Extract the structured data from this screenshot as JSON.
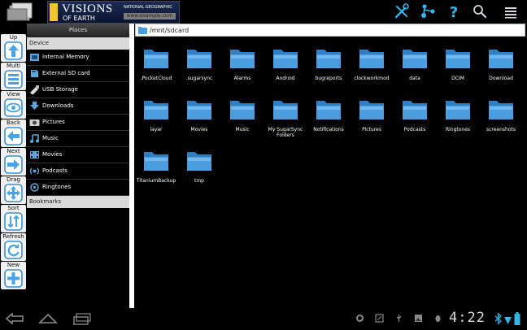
{
  "banner": {
    "title": "VISIONS",
    "subtitle": "OF EARTH",
    "brand": "NATIONAL GEOGRAPHIC",
    "link": "www.example.com"
  },
  "top_icons": [
    "tools-icon",
    "share-icon",
    "help-icon",
    "search-icon",
    "menu-icon"
  ],
  "toolbar": [
    {
      "label": "Up",
      "icon": "arrow-up-icon"
    },
    {
      "label": "Multi",
      "icon": "multi-select-icon"
    },
    {
      "label": "View",
      "icon": "view-icon"
    },
    {
      "label": "Back",
      "icon": "arrow-left-icon"
    },
    {
      "label": "Next",
      "icon": "arrow-right-icon"
    },
    {
      "label": "Drag",
      "icon": "drag-icon"
    },
    {
      "label": "Sort",
      "icon": "sort-icon"
    },
    {
      "label": "Refresh",
      "icon": "refresh-icon"
    },
    {
      "label": "New",
      "icon": "plus-icon"
    }
  ],
  "places": {
    "title": "Places",
    "device_label": "Device",
    "bookmarks_label": "Bookmarks",
    "items": [
      {
        "label": "Internal Memory",
        "icon": "memory-icon"
      },
      {
        "label": "External SD card",
        "icon": "sdcard-icon"
      },
      {
        "label": "USB Storage",
        "icon": "usb-icon"
      },
      {
        "label": "Downloads",
        "icon": "download-icon"
      },
      {
        "label": "Pictures",
        "icon": "camera-icon"
      },
      {
        "label": "Music",
        "icon": "music-icon"
      },
      {
        "label": "Movies",
        "icon": "film-icon"
      },
      {
        "label": "Podcasts",
        "icon": "podcast-icon"
      },
      {
        "label": "Ringtones",
        "icon": "ringtone-icon"
      }
    ]
  },
  "path": "/mnt/sdcard",
  "files": [
    [
      ".PocketCloud",
      ".sugarsync",
      "Alarms",
      "Android",
      "bugreports",
      "clockworkmod",
      "data",
      "DCIM",
      "Download"
    ],
    [
      "layar",
      "Movies",
      "Music",
      "My SugarSync Folders",
      "Notifications",
      "Pictures",
      "Podcasts",
      "Ringtones",
      "screenshots"
    ],
    [
      "TitaniumBackup",
      "tmp"
    ]
  ],
  "status": {
    "time": "4:22"
  },
  "colors": {
    "folder": "#4a9ee0",
    "accent": "#33b5e5"
  }
}
